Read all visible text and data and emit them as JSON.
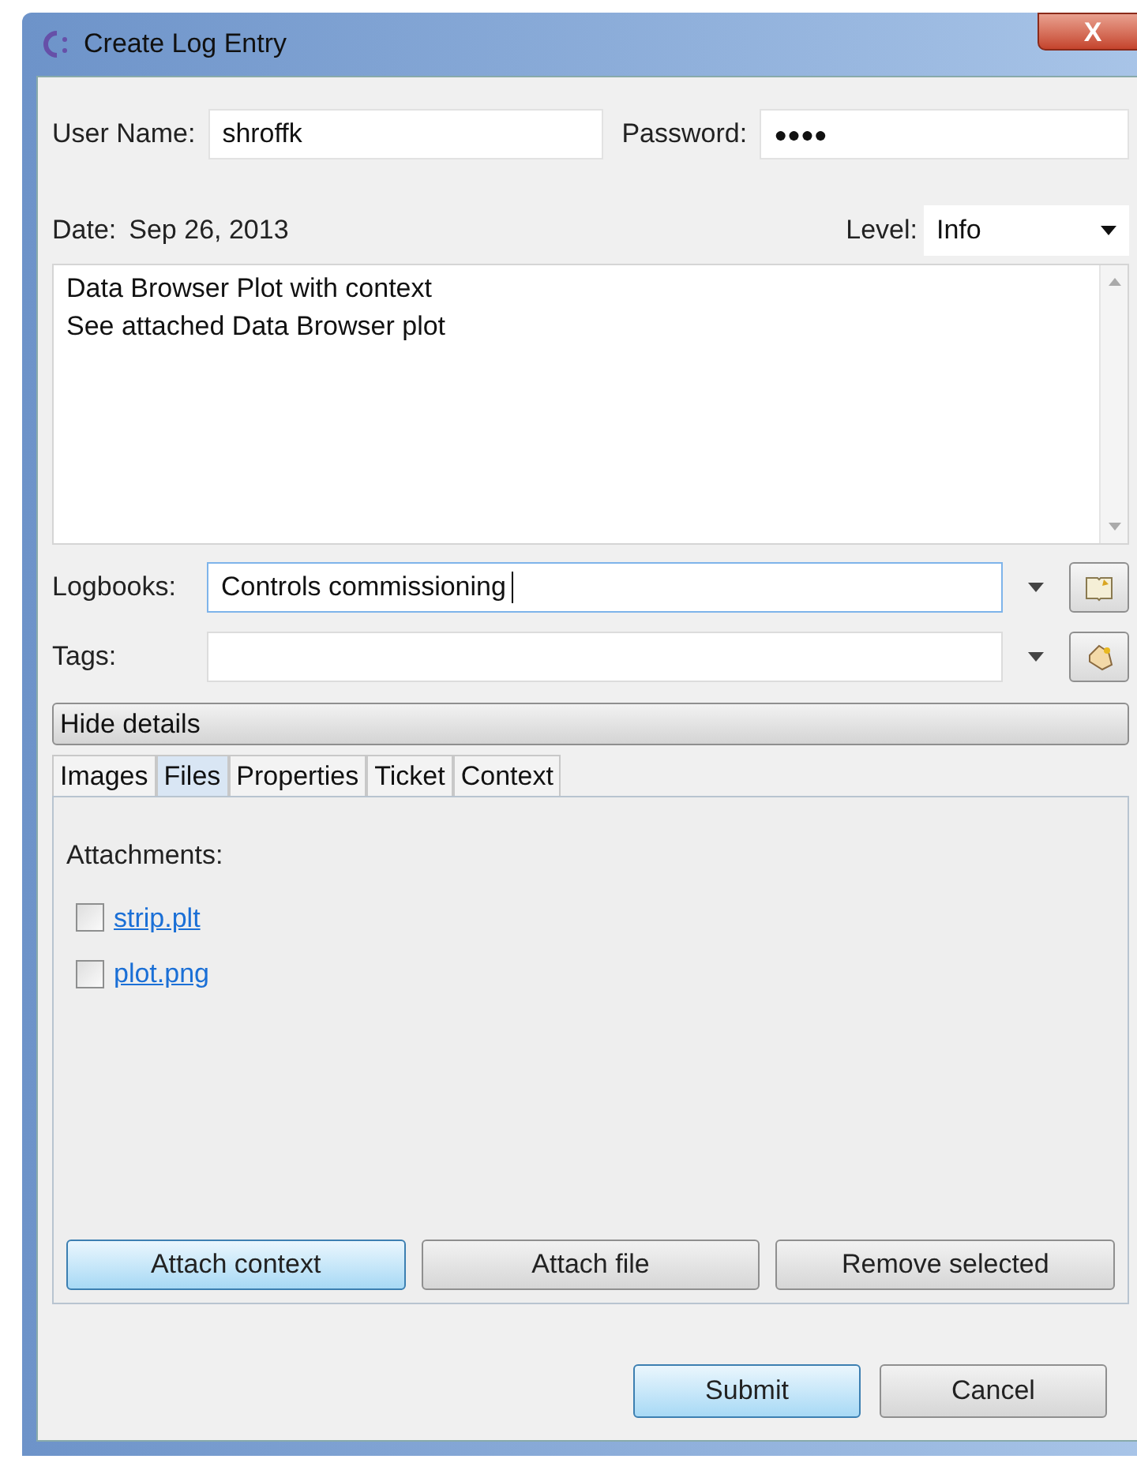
{
  "window": {
    "title": "Create Log Entry",
    "close": "X"
  },
  "user": {
    "label": "User Name:",
    "value": "shroffk"
  },
  "password": {
    "label": "Password:",
    "value": "●●●●"
  },
  "date": {
    "label": "Date:",
    "value": "Sep 26, 2013"
  },
  "level": {
    "label": "Level:",
    "value": "Info"
  },
  "description": [
    "Data Browser Plot with context",
    "See attached Data Browser plot"
  ],
  "logbooks": {
    "label": "Logbooks:",
    "value": "Controls commissioning",
    "focused": true
  },
  "tags": {
    "label": "Tags:",
    "focused": false
  },
  "details_toggle": "Hide details",
  "tabs": [
    {
      "label": "Images",
      "selected": false
    },
    {
      "label": "Files",
      "selected": true
    },
    {
      "label": "Properties",
      "selected": false
    },
    {
      "label": "Ticket",
      "selected": false
    },
    {
      "label": "Context",
      "selected": false
    }
  ],
  "attachments": {
    "label": "Attachments:",
    "files": [
      {
        "name": "strip.plt",
        "checked": false
      },
      {
        "name": "plot.png",
        "checked": false
      }
    ]
  },
  "attach_buttons": [
    {
      "label": "Attach context",
      "highlighted": true
    },
    {
      "label": "Attach file",
      "highlighted": false
    },
    {
      "label": "Remove selected",
      "highlighted": false
    }
  ],
  "dialog_buttons": [
    {
      "label": "Submit",
      "highlighted": true
    },
    {
      "label": "Cancel",
      "highlighted": false
    }
  ]
}
